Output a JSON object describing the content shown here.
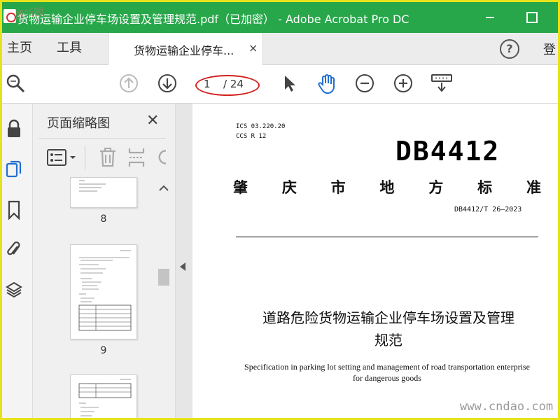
{
  "window": {
    "title": "货物运输企业停车场设置及管理规范.pdf（已加密） - Adobe Acrobat Pro DC",
    "watermark_corner": "清听园"
  },
  "menu": {
    "home": "主页",
    "tools": "工具",
    "doc_tab": "货物运输企业停车...",
    "doc_tab_close": "×",
    "help": "?",
    "login": "登"
  },
  "toolbar": {
    "page_current": "1",
    "page_total": "/ 24"
  },
  "panel": {
    "title": "页面缩略图",
    "close": "✕",
    "thumbnails": [
      {
        "label": "8"
      },
      {
        "label": "9"
      },
      {
        "label": ""
      }
    ]
  },
  "document": {
    "ics": "ICS  03.220.20",
    "ccs": "CCS  R 12",
    "code": "DB4412",
    "city_chars": [
      "肇",
      "庆",
      "市",
      "地",
      "方",
      "标",
      "准"
    ],
    "number": "DB4412/T 26—2023",
    "title_line1": "道路危险货物运输企业停车场设置及管理",
    "title_line2": "规范",
    "subtitle_line1": "Specification in parking lot setting and management of road transportation enterprise",
    "subtitle_line2": "for dangerous goods"
  },
  "watermark": {
    "site": "www.cndao.com"
  },
  "colors": {
    "titlebar": "#27a74a",
    "frame": "#e8e21a",
    "highlight_ring": "#d3211d",
    "hand_tool": "#1f6fd1"
  },
  "icons": {
    "zoom": "magnifier-icon",
    "up": "arrow-up-circle-icon",
    "down": "arrow-down-circle-icon",
    "select": "cursor-icon",
    "hand": "hand-icon",
    "zoom_out": "minus-circle-icon",
    "zoom_in": "plus-circle-icon",
    "more": "keyboard-tool-icon",
    "lock": "lock-icon",
    "pages": "pages-icon",
    "bookmark": "bookmark-icon",
    "attach": "paperclip-icon",
    "layers": "layers-icon"
  }
}
